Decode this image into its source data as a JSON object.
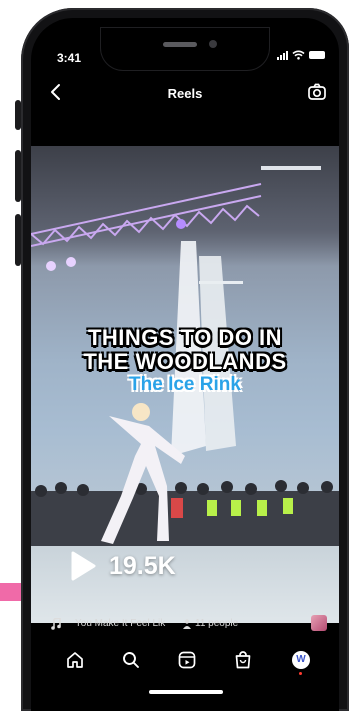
{
  "status_bar": {
    "time": "3:41"
  },
  "top_nav": {
    "title": "Reels"
  },
  "video": {
    "caption_line1": "Things to do in",
    "caption_line2": "The Woodlands",
    "caption_subtitle": "The Ice Rink",
    "view_count": "19.5K"
  },
  "audio": {
    "track": "You Make It Feel Lik",
    "people": "11 people"
  },
  "tabs": [
    {
      "icon": "home-icon"
    },
    {
      "icon": "search-icon"
    },
    {
      "icon": "reels-icon"
    },
    {
      "icon": "shop-icon"
    },
    {
      "icon": "profile-avatar",
      "initial": "W"
    }
  ],
  "colors": {
    "accent_pink": "#f06aa8",
    "caption_blue": "#2aa3e8",
    "background": "#000000"
  }
}
